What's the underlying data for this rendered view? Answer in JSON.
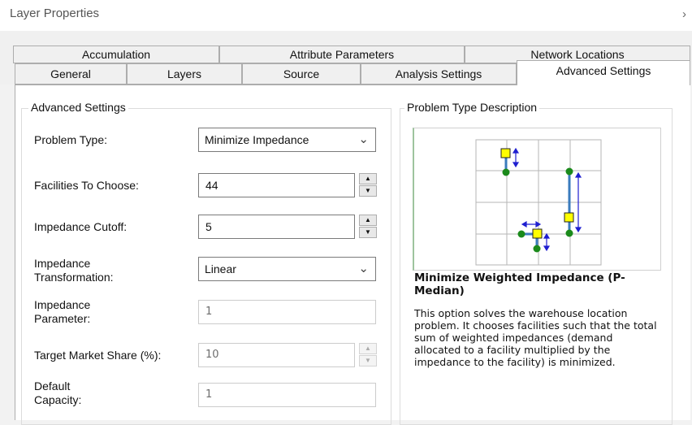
{
  "window": {
    "title": "Layer Properties",
    "close_glyph": "›"
  },
  "tabs": {
    "row_back": [
      {
        "label": "Accumulation"
      },
      {
        "label": "Attribute Parameters"
      },
      {
        "label": "Network Locations"
      }
    ],
    "row_front": [
      {
        "label": "General"
      },
      {
        "label": "Layers"
      },
      {
        "label": "Source"
      },
      {
        "label": "Analysis Settings"
      },
      {
        "label": "Advanced Settings",
        "active": true
      }
    ]
  },
  "advanced": {
    "group_title": "Advanced Settings",
    "problem_type": {
      "label": "Problem Type:",
      "value": "Minimize Impedance"
    },
    "facilities": {
      "label": "Facilities To Choose:",
      "value": "44"
    },
    "cutoff": {
      "label": "Impedance Cutoff:",
      "value": "5"
    },
    "transformation": {
      "label_line1": "Impedance",
      "label_line2": "Transformation:",
      "value": "Linear"
    },
    "parameter": {
      "label_line1": "Impedance",
      "label_line2": "Parameter:",
      "value": "1"
    },
    "market_share": {
      "label": "Target Market Share (%):",
      "value": "10"
    },
    "capacity": {
      "label_line1": "Default",
      "label_line2": "Capacity:",
      "value": "1"
    }
  },
  "description": {
    "group_title": "Problem Type Description",
    "heading": "Minimize Weighted Impedance (P-Median)",
    "body": "This option solves the warehouse location problem. It chooses facilities such that the total sum of weighted impedances (demand allocated to a facility multiplied by the impedance to the facility) is minimized."
  },
  "colors": {
    "facility_fill": "#ffff00",
    "demand_point": "#1b8a1b",
    "allocation_line": "#3a7bbd",
    "arrow": "#1f1fd0"
  },
  "icons": [
    "chevron-right-icon",
    "chevron-down-icon",
    "spin-up-icon",
    "spin-down-icon"
  ]
}
